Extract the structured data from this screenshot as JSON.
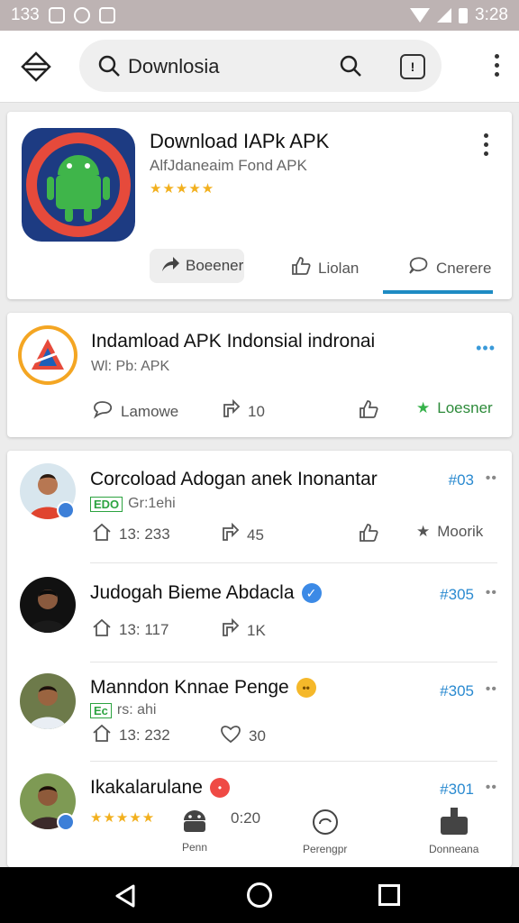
{
  "status_bar": {
    "time_left": "133",
    "time_right": "3:28"
  },
  "search": {
    "value": "Downlosia"
  },
  "featured": {
    "title": "Download IAPk APK",
    "subtitle": "AlfJdaneaim Fond APK",
    "rating_stars": "★★★★★",
    "share_label": "Boeener",
    "like_label": "Liolan",
    "comment_label": "Cnerere"
  },
  "card2": {
    "title": "Indamload APK Indonsial indronai",
    "subtitle": "Wl: Pb: APK",
    "more": "•••",
    "comment_label": "Lamowe",
    "share_count": "10",
    "fav_label": "Loesner"
  },
  "posts": [
    {
      "name": "Corcoload Adogan anek Inonantar",
      "tag": "#03",
      "badge": "EDO",
      "badge_text": "Gr:1ehi",
      "views": "13: 233",
      "shares": "45",
      "more_label": "Moorik"
    },
    {
      "name": "Judogah Bieme Abdacla",
      "tag": "#305",
      "views": "13: 117",
      "shares": "1K"
    },
    {
      "name": "Manndon Knnae Penge",
      "tag": "#305",
      "badge": "Ec",
      "badge_text": "rs: ahi",
      "views": "13: 232",
      "likes": "30"
    },
    {
      "name": "Ikakalarulane",
      "tag": "#301",
      "rating_stars": "★★★★★",
      "count": "0:20"
    }
  ],
  "bottom_tabs": [
    {
      "label": "Penn",
      "icon": "android-icon"
    },
    {
      "label": "Perengpr",
      "icon": "refresh-icon"
    },
    {
      "label": "Donneana",
      "icon": "download-icon"
    }
  ]
}
